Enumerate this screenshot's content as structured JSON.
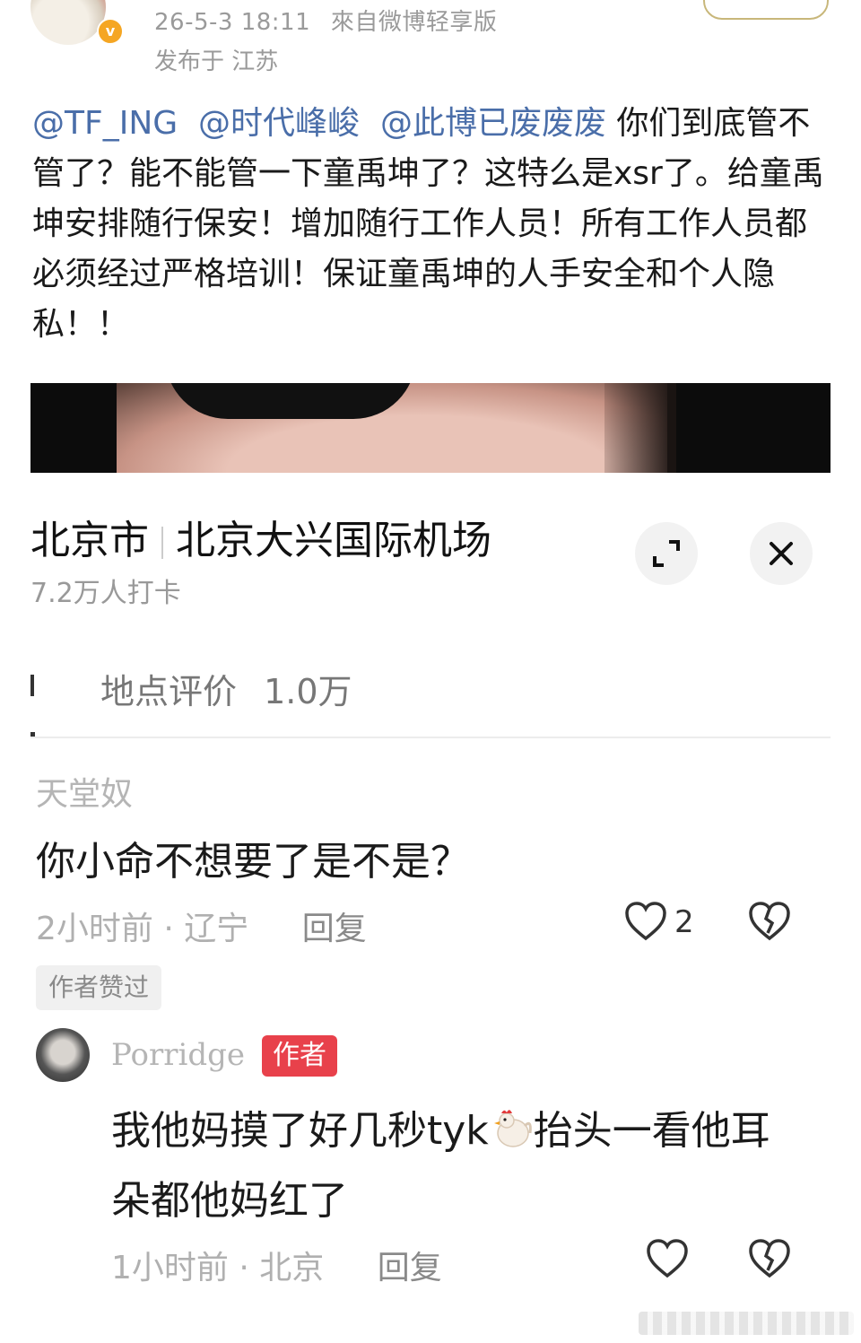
{
  "header": {
    "timestamp": "26-5-3 18:11",
    "source": "來自微博轻享版",
    "location_line": "发布于 江苏"
  },
  "post": {
    "mentions": [
      "@TF_ING",
      "@时代峰峻",
      "@此博已废废废"
    ],
    "text": "你们到底管不管了？能不能管一下童禹坤了？这特么是xsr了。给童禹坤安排随行保安！增加随行工作人员！所有工作人员都必须经过严格培训！保证童禹坤的人手安全和个人隐私！！"
  },
  "location_card": {
    "city": "北京市",
    "place": "北京大兴国际机场",
    "checkins": "7.2万人打卡",
    "rating_label": "地点评价",
    "rating_count": "1.0万"
  },
  "comments": [
    {
      "user": "天堂奴",
      "text": "你小命不想要了是不是？",
      "time": "2小时前",
      "region": "辽宁",
      "reply_label": "回复",
      "likes": "2",
      "badge": "作者赞过"
    },
    {
      "user": "Porridge",
      "author_tag": "作者",
      "text_before": "我他妈摸了好几秒tyk",
      "text_after": "抬头一看他耳朵都他妈红了",
      "time": "1小时前",
      "region": "北京",
      "reply_label": "回复"
    }
  ],
  "icons": {
    "verified": "verified-badge-icon",
    "expand": "expand-icon",
    "close": "close-icon",
    "like": "heart-icon",
    "dislike": "broken-heart-icon",
    "emoji": "rooster-emoji-icon"
  },
  "colors": {
    "mention": "#4a6ea9",
    "author_tag": "#e8414b",
    "muted": "#b0b0b0"
  }
}
